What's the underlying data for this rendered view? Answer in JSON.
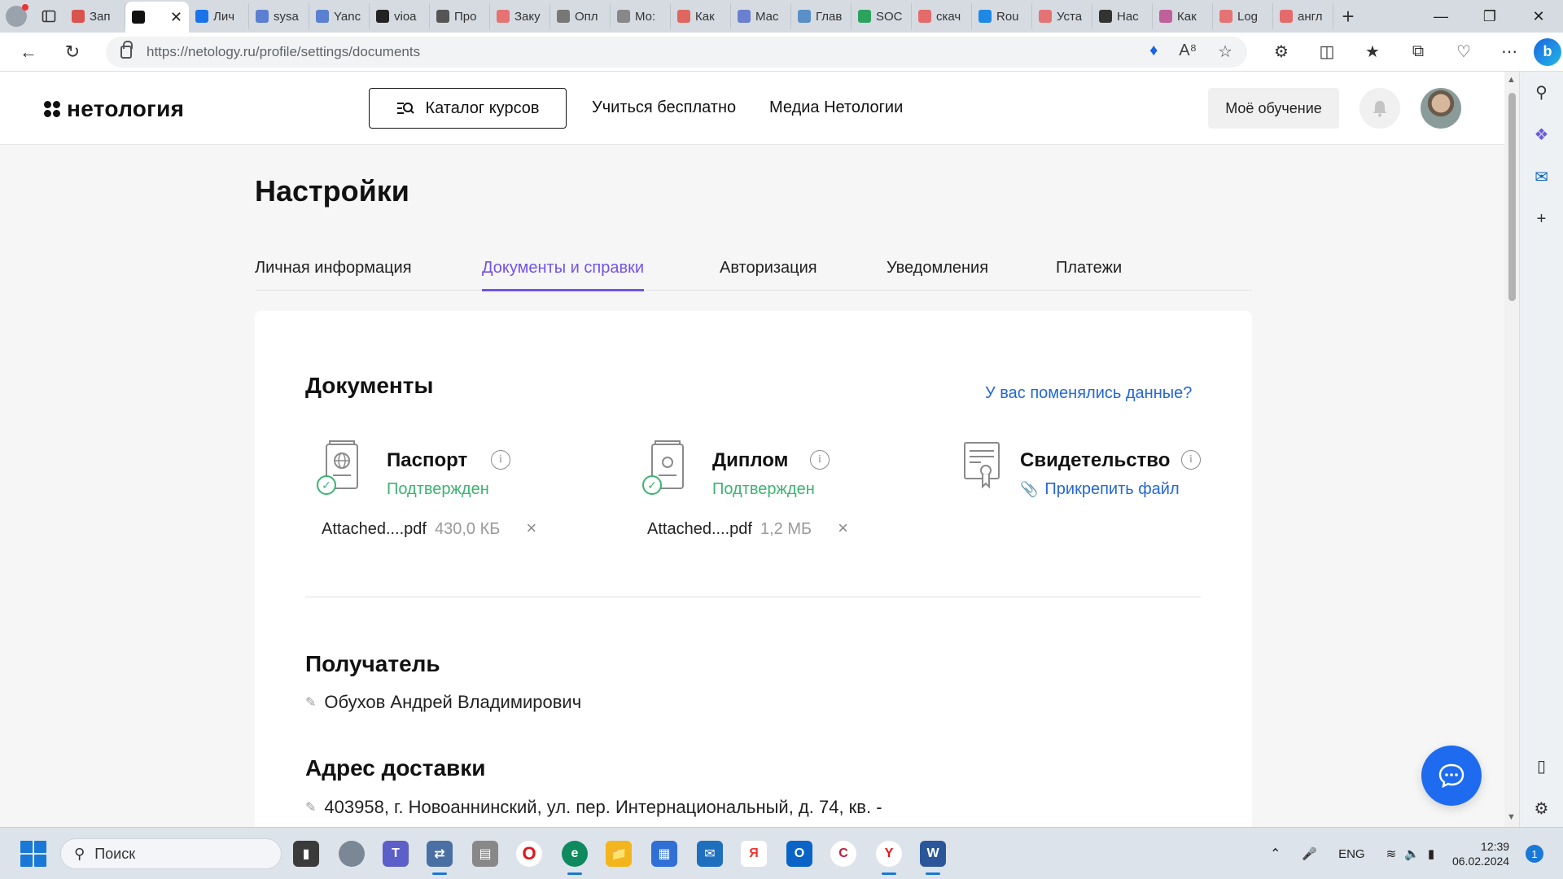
{
  "browser": {
    "tabs": [
      {
        "label": "Зап",
        "color": "#d9534f"
      },
      {
        "label": "",
        "color": "#111111",
        "active": true
      },
      {
        "label": "Лич",
        "color": "#1a73e8"
      },
      {
        "label": "sysa",
        "color": "#5b7fd1"
      },
      {
        "label": "Yanc",
        "color": "#5b7fd1"
      },
      {
        "label": "vioa",
        "color": "#222222"
      },
      {
        "label": "Про",
        "color": "#555555"
      },
      {
        "label": "Заку",
        "color": "#e57373"
      },
      {
        "label": "Опл",
        "color": "#777777"
      },
      {
        "label": "Мо:",
        "color": "#888888"
      },
      {
        "label": "Как",
        "color": "#e0665f"
      },
      {
        "label": "Мас",
        "color": "#6a7fd0"
      },
      {
        "label": "Глав",
        "color": "#5a8fc7"
      },
      {
        "label": "SOC",
        "color": "#2ca25f"
      },
      {
        "label": "скач",
        "color": "#e56b6b"
      },
      {
        "label": "Rou",
        "color": "#1e88e5"
      },
      {
        "label": "Уста",
        "color": "#e57373"
      },
      {
        "label": "Нас",
        "color": "#333333"
      },
      {
        "label": "Как",
        "color": "#c0609a"
      },
      {
        "label": "Log",
        "color": "#e57373"
      },
      {
        "label": "англ",
        "color": "#e56b6b"
      }
    ],
    "url": "https://netology.ru/profile/settings/documents"
  },
  "header": {
    "logo": "нетология",
    "catalog_button": "Каталог курсов",
    "link_free": "Учиться бесплатно",
    "link_media": "Медиа Нетологии",
    "my_learning": "Моё обучение"
  },
  "page": {
    "title": "Настройки",
    "tabs": [
      {
        "label": "Личная информация",
        "active": false
      },
      {
        "label": "Документы и справки",
        "active": true
      },
      {
        "label": "Авторизация",
        "active": false
      },
      {
        "label": "Уведомления",
        "active": false
      },
      {
        "label": "Платежи",
        "active": false
      }
    ]
  },
  "documents": {
    "heading": "Документы",
    "changed_link": "У вас поменялись данные?",
    "items": [
      {
        "title": "Паспорт",
        "status": "Подтвержден",
        "file_name": "Attached....pdf",
        "file_size": "430,0 КБ",
        "icon": "passport-icon"
      },
      {
        "title": "Диплом",
        "status": "Подтвержден",
        "file_name": "Attached....pdf",
        "file_size": "1,2 МБ",
        "icon": "diploma-icon"
      },
      {
        "title": "Свидетельство",
        "attach_label": "Прикрепить файл",
        "icon": "certificate-icon"
      }
    ]
  },
  "recipient": {
    "heading": "Получатель",
    "value": "Обухов Андрей Владимирович"
  },
  "delivery": {
    "heading": "Адрес доставки",
    "value": "403958, г. Новоаннинский, ул. пер. Интернациональный, д. 74, кв. -"
  },
  "taskbar": {
    "search_placeholder": "Поиск",
    "language": "ENG",
    "time": "12:39",
    "date": "06.02.2024",
    "notifications": "1"
  },
  "colors": {
    "accent": "#7253ed",
    "link": "#2567d9",
    "success": "#3cb371",
    "chat": "#1e6bf0"
  }
}
